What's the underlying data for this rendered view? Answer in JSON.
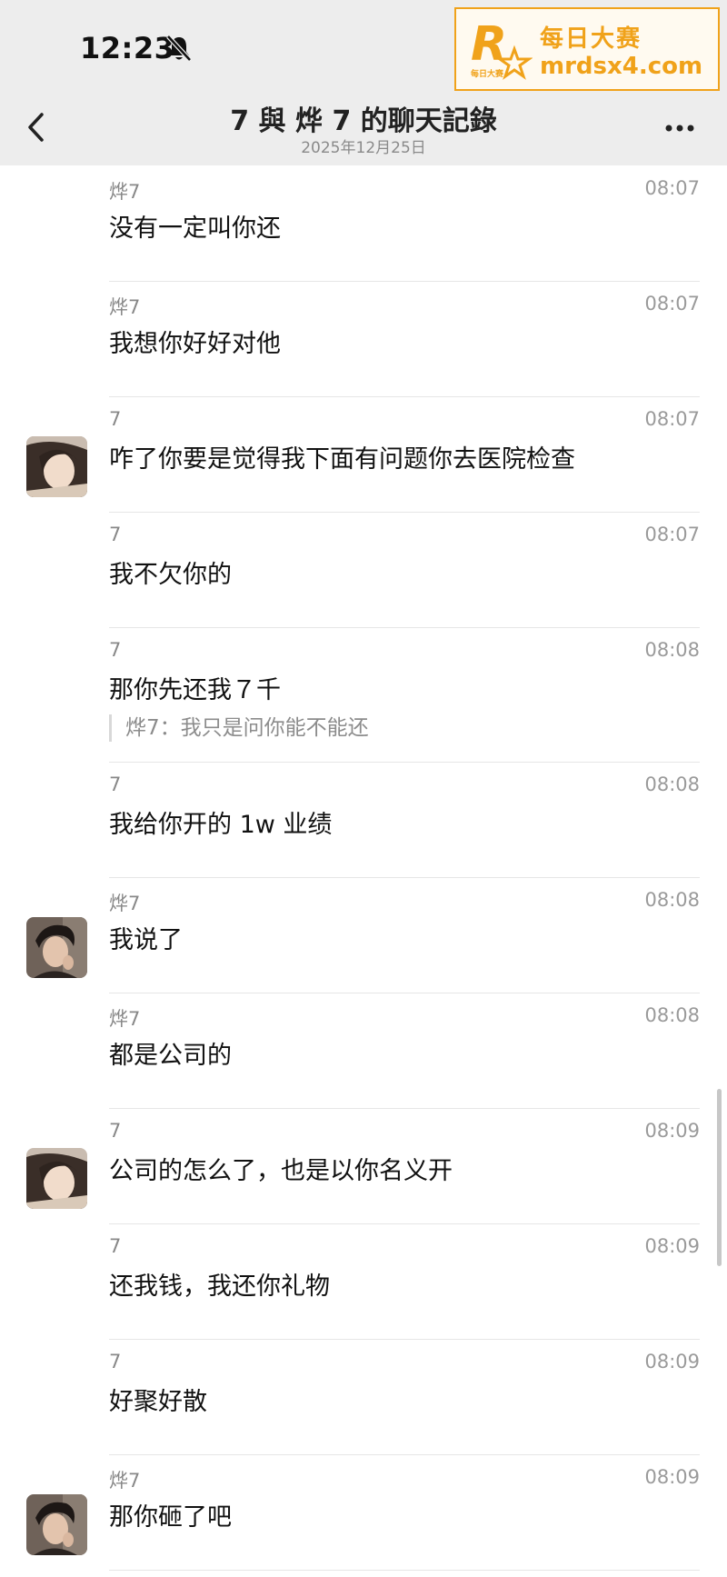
{
  "status_bar": {
    "time": "12:23"
  },
  "watermark": {
    "logo_small": "每日大赛",
    "line1": "每日大赛",
    "line2": "mrdsx4.com",
    "color": "#f0a21a"
  },
  "nav": {
    "title": "7 與 烨 7 的聊天記錄",
    "subtitle": "2025年12月25日"
  },
  "icons": {
    "bell": "bell-slash-icon",
    "back": "chevron-left-icon",
    "more": "more-icon"
  },
  "messages": [
    {
      "sender": "烨7",
      "time": "08:07",
      "text": "没有一定叫你还",
      "avatar": null
    },
    {
      "sender": "烨7",
      "time": "08:07",
      "text": "我想你好好对他",
      "avatar": null
    },
    {
      "sender": "7",
      "time": "08:07",
      "text": "咋了你要是觉得我下面有问题你去医院检查",
      "avatar": "female"
    },
    {
      "sender": "7",
      "time": "08:07",
      "text": "我不欠你的",
      "avatar": null
    },
    {
      "sender": "7",
      "time": "08:08",
      "text": "那你先还我７千",
      "avatar": null,
      "quote": "烨7：我只是问你能不能还"
    },
    {
      "sender": "7",
      "time": "08:08",
      "text": "我给你开的 1w 业绩",
      "avatar": null
    },
    {
      "sender": "烨7",
      "time": "08:08",
      "text": "我说了",
      "avatar": "male"
    },
    {
      "sender": "烨7",
      "time": "08:08",
      "text": "都是公司的",
      "avatar": null
    },
    {
      "sender": "7",
      "time": "08:09",
      "text": "公司的怎么了，也是以你名义开",
      "avatar": "female"
    },
    {
      "sender": "7",
      "time": "08:09",
      "text": "还我钱，我还你礼物",
      "avatar": null
    },
    {
      "sender": "7",
      "time": "08:09",
      "text": "好聚好散",
      "avatar": null
    },
    {
      "sender": "烨7",
      "time": "08:09",
      "text": "那你砸了吧",
      "avatar": "male"
    }
  ]
}
